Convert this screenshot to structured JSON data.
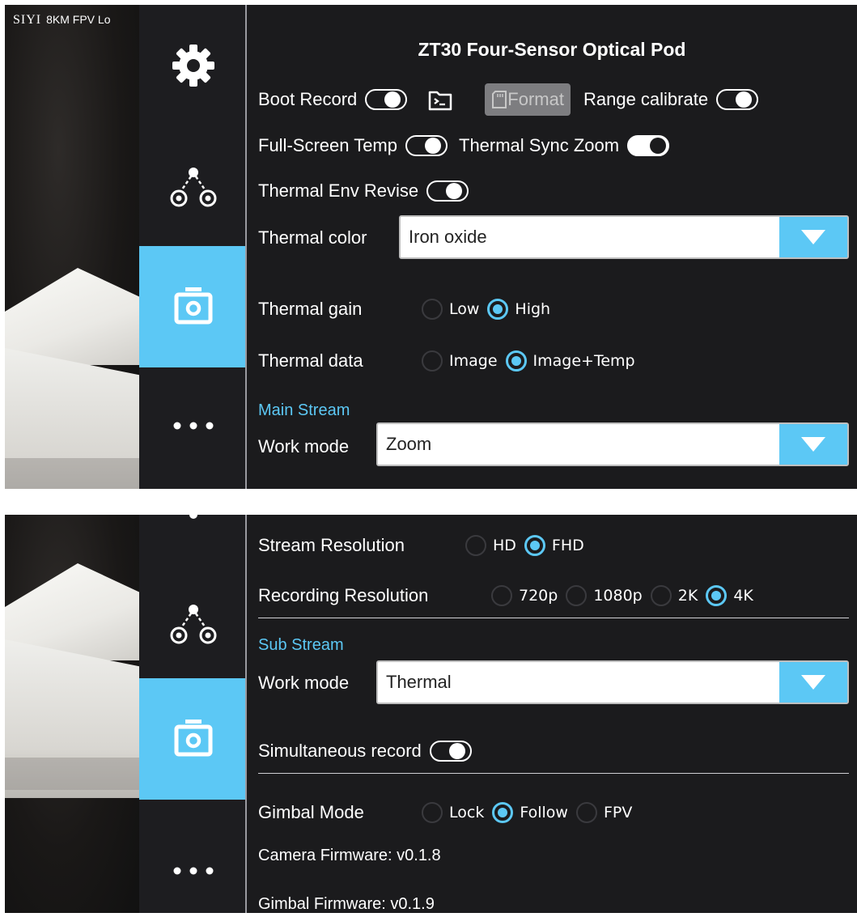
{
  "panel1": {
    "camera_label": {
      "brand": "SIYI",
      "text": "8KM FPV Lo"
    },
    "title": "ZT30 Four-Sensor Optical Pod",
    "boot_record": {
      "label": "Boot Record",
      "state": "off"
    },
    "format_label": "Format",
    "range_calibrate": {
      "label": "Range calibrate",
      "state": "off"
    },
    "full_screen_temp": {
      "label": "Full-Screen Temp",
      "state": "off"
    },
    "thermal_sync_zoom": {
      "label": "Thermal Sync Zoom",
      "state": "on"
    },
    "thermal_env_revise": {
      "label": "Thermal Env Revise",
      "state": "off"
    },
    "thermal_color": {
      "label": "Thermal color",
      "value": "Iron oxide"
    },
    "thermal_gain": {
      "label": "Thermal gain",
      "options": [
        "Low",
        "High"
      ],
      "selected": "High"
    },
    "thermal_data": {
      "label": "Thermal data",
      "options": [
        "Image",
        "Image+Temp"
      ],
      "selected": "Image+Temp"
    },
    "main_stream": {
      "section": "Main Stream",
      "work_mode_label": "Work mode",
      "work_mode_value": "Zoom"
    }
  },
  "panel2": {
    "stream_resolution": {
      "label": "Stream Resolution",
      "options": [
        "HD",
        "FHD"
      ],
      "selected": "FHD"
    },
    "recording_resolution": {
      "label": "Recording Resolution",
      "options": [
        "720p",
        "1080p",
        "2K",
        "4K"
      ],
      "selected": "4K"
    },
    "sub_stream": {
      "section": "Sub Stream",
      "work_mode_label": "Work mode",
      "work_mode_value": "Thermal"
    },
    "simultaneous_record": {
      "label": "Simultaneous record",
      "state": "off"
    },
    "gimbal_mode": {
      "label": "Gimbal Mode",
      "options": [
        "Lock",
        "Follow",
        "FPV"
      ],
      "selected": "Follow"
    },
    "camera_firmware": "Camera Firmware: v0.1.8",
    "gimbal_firmware": "Gimbal Firmware: v0.1.9"
  },
  "sidebar": {
    "active": "camera",
    "items": [
      "settings-gear",
      "gimbal-link",
      "camera",
      "more"
    ]
  },
  "colors": {
    "accent": "#5cc8f5",
    "panel_bg": "#1b1b1d"
  }
}
